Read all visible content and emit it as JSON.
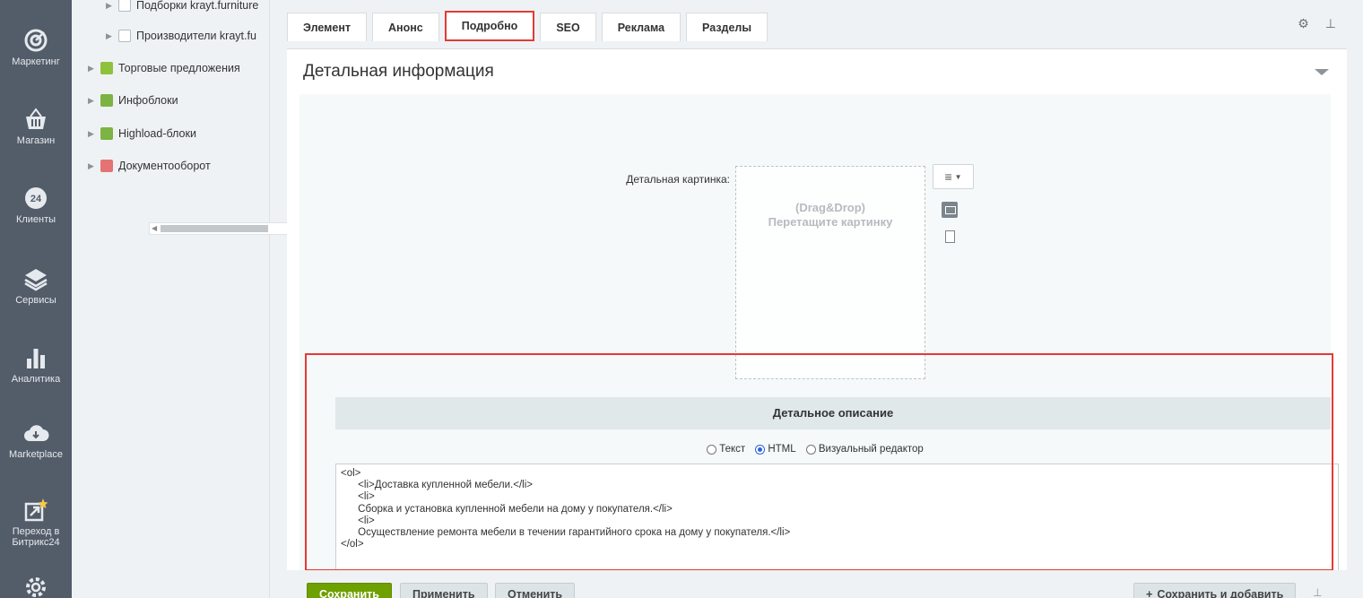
{
  "rail": {
    "items": [
      {
        "label": "Маркетинг",
        "icon": "target-icon"
      },
      {
        "label": "Магазин",
        "icon": "basket-icon"
      },
      {
        "label": "Клиенты",
        "icon": "clients-24-icon"
      },
      {
        "label": "Сервисы",
        "icon": "layers-icon"
      },
      {
        "label": "Аналитика",
        "icon": "bar-chart-icon"
      },
      {
        "label": "Marketplace",
        "icon": "cloud-download-icon"
      },
      {
        "label": "Переход в Битрикс24",
        "icon": "bitrix-transfer-icon"
      }
    ]
  },
  "tree": {
    "items": [
      {
        "label": "Подборки krayt.furniture"
      },
      {
        "label": "Производители krayt.fu"
      },
      {
        "label": "Торговые предложения"
      },
      {
        "label": "Инфоблоки"
      },
      {
        "label": "Highload-блоки"
      },
      {
        "label": "Документооборот"
      }
    ]
  },
  "tabs": [
    {
      "label": "Элемент"
    },
    {
      "label": "Анонс"
    },
    {
      "label": "Подробно",
      "active": true
    },
    {
      "label": "SEO"
    },
    {
      "label": "Реклама"
    },
    {
      "label": "Разделы"
    }
  ],
  "panel": {
    "title": "Детальная информация",
    "image_label": "Детальная картинка:",
    "dropzone_line1": "(Drag&Drop)",
    "dropzone_line2": "Перетащите картинку",
    "description_header": "Детальное описание",
    "modes": {
      "text": "Текст",
      "html": "HTML",
      "visual": "Визуальный редактор",
      "selected": "HTML"
    },
    "code": "<ol>\n\t<li>Доставка купленной мебели.</li>\n\t<li>\n\tСборка и установка купленной мебели на дому у покупателя.</li>\n\t<li>\n\tОсуществление ремонта мебели в течении гарантийного срока на дому у покупателя.</li>\n</ol>"
  },
  "footer": {
    "save": "Сохранить",
    "apply": "Применить",
    "cancel": "Отменить",
    "save_add": "Сохранить и добавить"
  },
  "colors": {
    "rail": "#535c69",
    "highlight": "#e53935",
    "save": "#6ea000"
  }
}
